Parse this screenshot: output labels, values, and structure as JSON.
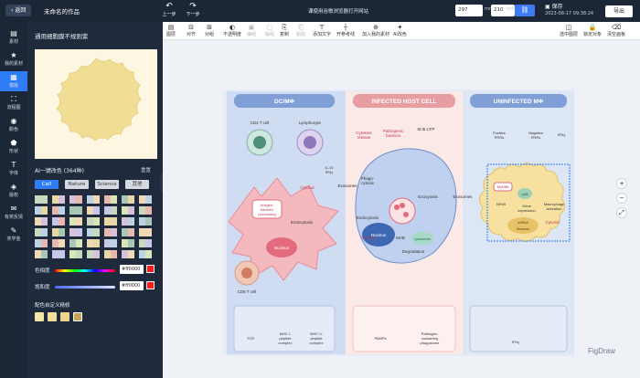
{
  "titlebar": {
    "back": "返回",
    "doc_name": "未命名的作品",
    "undo": "上一步",
    "redo": "下一步",
    "center": "课使用谷歌浏览器打开网站",
    "width": "297",
    "width_unit": "mm",
    "height": "210",
    "height_unit": "mm",
    "save": "保存",
    "save_time": "2023-08-17 09:38:24",
    "export": "导出"
  },
  "icon_bar": [
    {
      "icon": "素材",
      "label": "素材"
    },
    {
      "icon": "我的素材",
      "label": "我的素材"
    },
    {
      "icon": "模版",
      "label": "模版"
    },
    {
      "icon": "流程图",
      "label": "流程图"
    },
    {
      "icon": "颜色",
      "label": "颜色"
    },
    {
      "icon": "形状",
      "label": "形状"
    },
    {
      "icon": "字体",
      "label": "字体"
    },
    {
      "icon": "版权",
      "label": "版权"
    },
    {
      "icon": "有奖反馈",
      "label": "有奖反馈"
    },
    {
      "icon": "奖学金",
      "label": "奖学金"
    }
  ],
  "panel": {
    "title": "通用细胞膜不规则紫",
    "ai_label": "AI一键改色 (364种)",
    "reset": "重置",
    "tabs": [
      "Cell",
      "Nature",
      "Science",
      "其他"
    ],
    "hue_label": "色相度",
    "hue_value": "#ff0000",
    "sat_label": "饱和度",
    "sat_value": "#ff0000",
    "custom_label": "配色自定义精修",
    "custom_colors": [
      "#f3e6a8",
      "#f1dc9a",
      "#efd48b",
      "#c9a25a"
    ]
  },
  "toolbar": [
    {
      "label": "图层",
      "dis": false
    },
    {
      "label": "对齐",
      "dis": false
    },
    {
      "label": "对组",
      "dis": false
    },
    {
      "label": "不透明度",
      "dis": false
    },
    {
      "label": "编组",
      "dis": true
    },
    {
      "label": "解组",
      "dis": true
    },
    {
      "label": "复制",
      "dis": false
    },
    {
      "label": "粘贴",
      "dis": true
    },
    {
      "label": "添加文字",
      "dis": false
    },
    {
      "label": "开参考线",
      "dis": false
    },
    {
      "label": "加入我的素材",
      "dis": false
    },
    {
      "label": "AI改色",
      "dis": false
    },
    {
      "label": "选中图层",
      "dis": false
    },
    {
      "label": "锁定对象",
      "dis": false
    },
    {
      "label": "清空画板",
      "dis": false
    }
  ],
  "figure": {
    "left_title": "DC/MΦ",
    "mid_title": "INFECTED HOST CELL",
    "right_title": "UNINFECTED MΦ",
    "cd4": "CD4 T cell",
    "lympho": "Lymphocyte",
    "il10": "IL-10\nIFNγ",
    "cytokine": "Cytokine\nrelease",
    "pathogenic": "Pathogenic\nbacteria",
    "mtb": "M.tb CFP",
    "cytosol": "Cytosol",
    "exosomes": "Exosomes",
    "antigen": "Antigen-\ntransfer/\nprocessing",
    "endocytosis": "Endocytosis",
    "nucleus": "Nucleus",
    "cd8": "CD8 T cell",
    "phago": "Phago-\ncytosis",
    "exocytosis": "Exocytosis",
    "mvb": "MVB",
    "lysosome": "Lysosome",
    "degradation": "Degradation",
    "pos_prr": "Positive\nPRRs",
    "neg_prr": "Negative\nPRRs",
    "ifny": "IFNγ",
    "myd88": "MyD88",
    "p38": "p38",
    "nfkb": "NFκB",
    "gene": "Gene\nexpression",
    "macro": "Macrophage\nactivation",
    "mrna": "mRNA",
    "tcr": "TCR",
    "mhc1": "MHC I-\npeptide\ncomplex",
    "mhc2": "MHC II-\npeptide\ncomplex",
    "pamps": "PAMPs",
    "patho_phago": "Pathogen-\ncontaining\nphagosome",
    "ifny2": "IFNγ",
    "watermark": "FigDraw"
  }
}
